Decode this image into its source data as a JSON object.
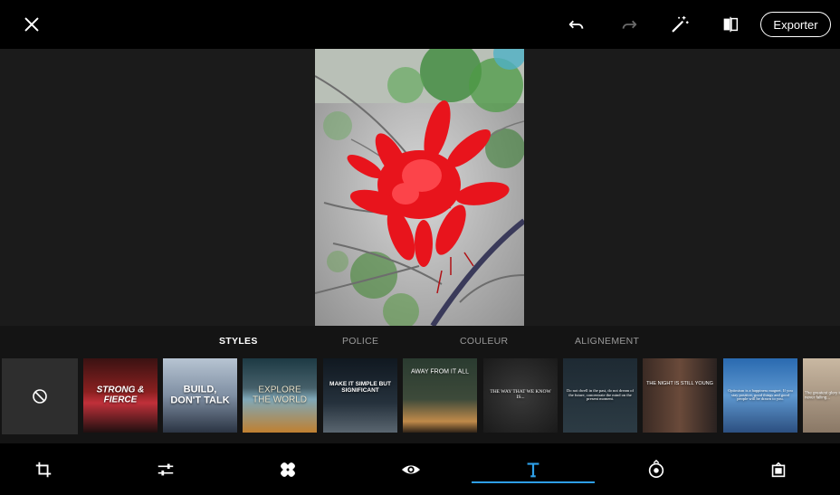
{
  "header": {
    "export_label": "Exporter",
    "icons": [
      "close-icon",
      "undo-icon",
      "redo-icon",
      "magic-wand-icon",
      "compare-icon"
    ]
  },
  "text_panel": {
    "tabs": [
      {
        "label": "STYLES",
        "active": true
      },
      {
        "label": "POLICE",
        "active": false
      },
      {
        "label": "COULEUR",
        "active": false
      },
      {
        "label": "ALIGNEMENT",
        "active": false
      }
    ],
    "styles": [
      {
        "caption": "STRONG &\nFIERCE"
      },
      {
        "caption": "BUILD,\nDON'T TALK"
      },
      {
        "caption": "EXPLORE\nTHE WORLD"
      },
      {
        "caption": "MAKE IT SIMPLE BUT\nSIGNIFICANT"
      },
      {
        "caption": "AWAY FROM IT ALL"
      },
      {
        "caption": "THE WAY THAT WE KNOW IS..."
      },
      {
        "caption": "Do not dwell in the past, do not dream of the future, concentrate the mind on the present moment."
      },
      {
        "caption": "THE NIGHT IS STILL YOUNG"
      },
      {
        "caption": "Optimism is a happiness magnet. If you stay positive, good things and good people will be drawn to you."
      },
      {
        "caption": "The greatest glory in living lies not in never falling..."
      }
    ]
  },
  "toolbar": {
    "icons": [
      "crop-icon",
      "adjust-sliders-icon",
      "heal-icon",
      "eye-icon",
      "text-icon",
      "sticker-icon",
      "frame-icon"
    ],
    "active_index": 4
  },
  "colors": {
    "accent": "#2e9fe8",
    "panel_bg": "#141414",
    "canvas_bg": "#1b1b1b"
  }
}
